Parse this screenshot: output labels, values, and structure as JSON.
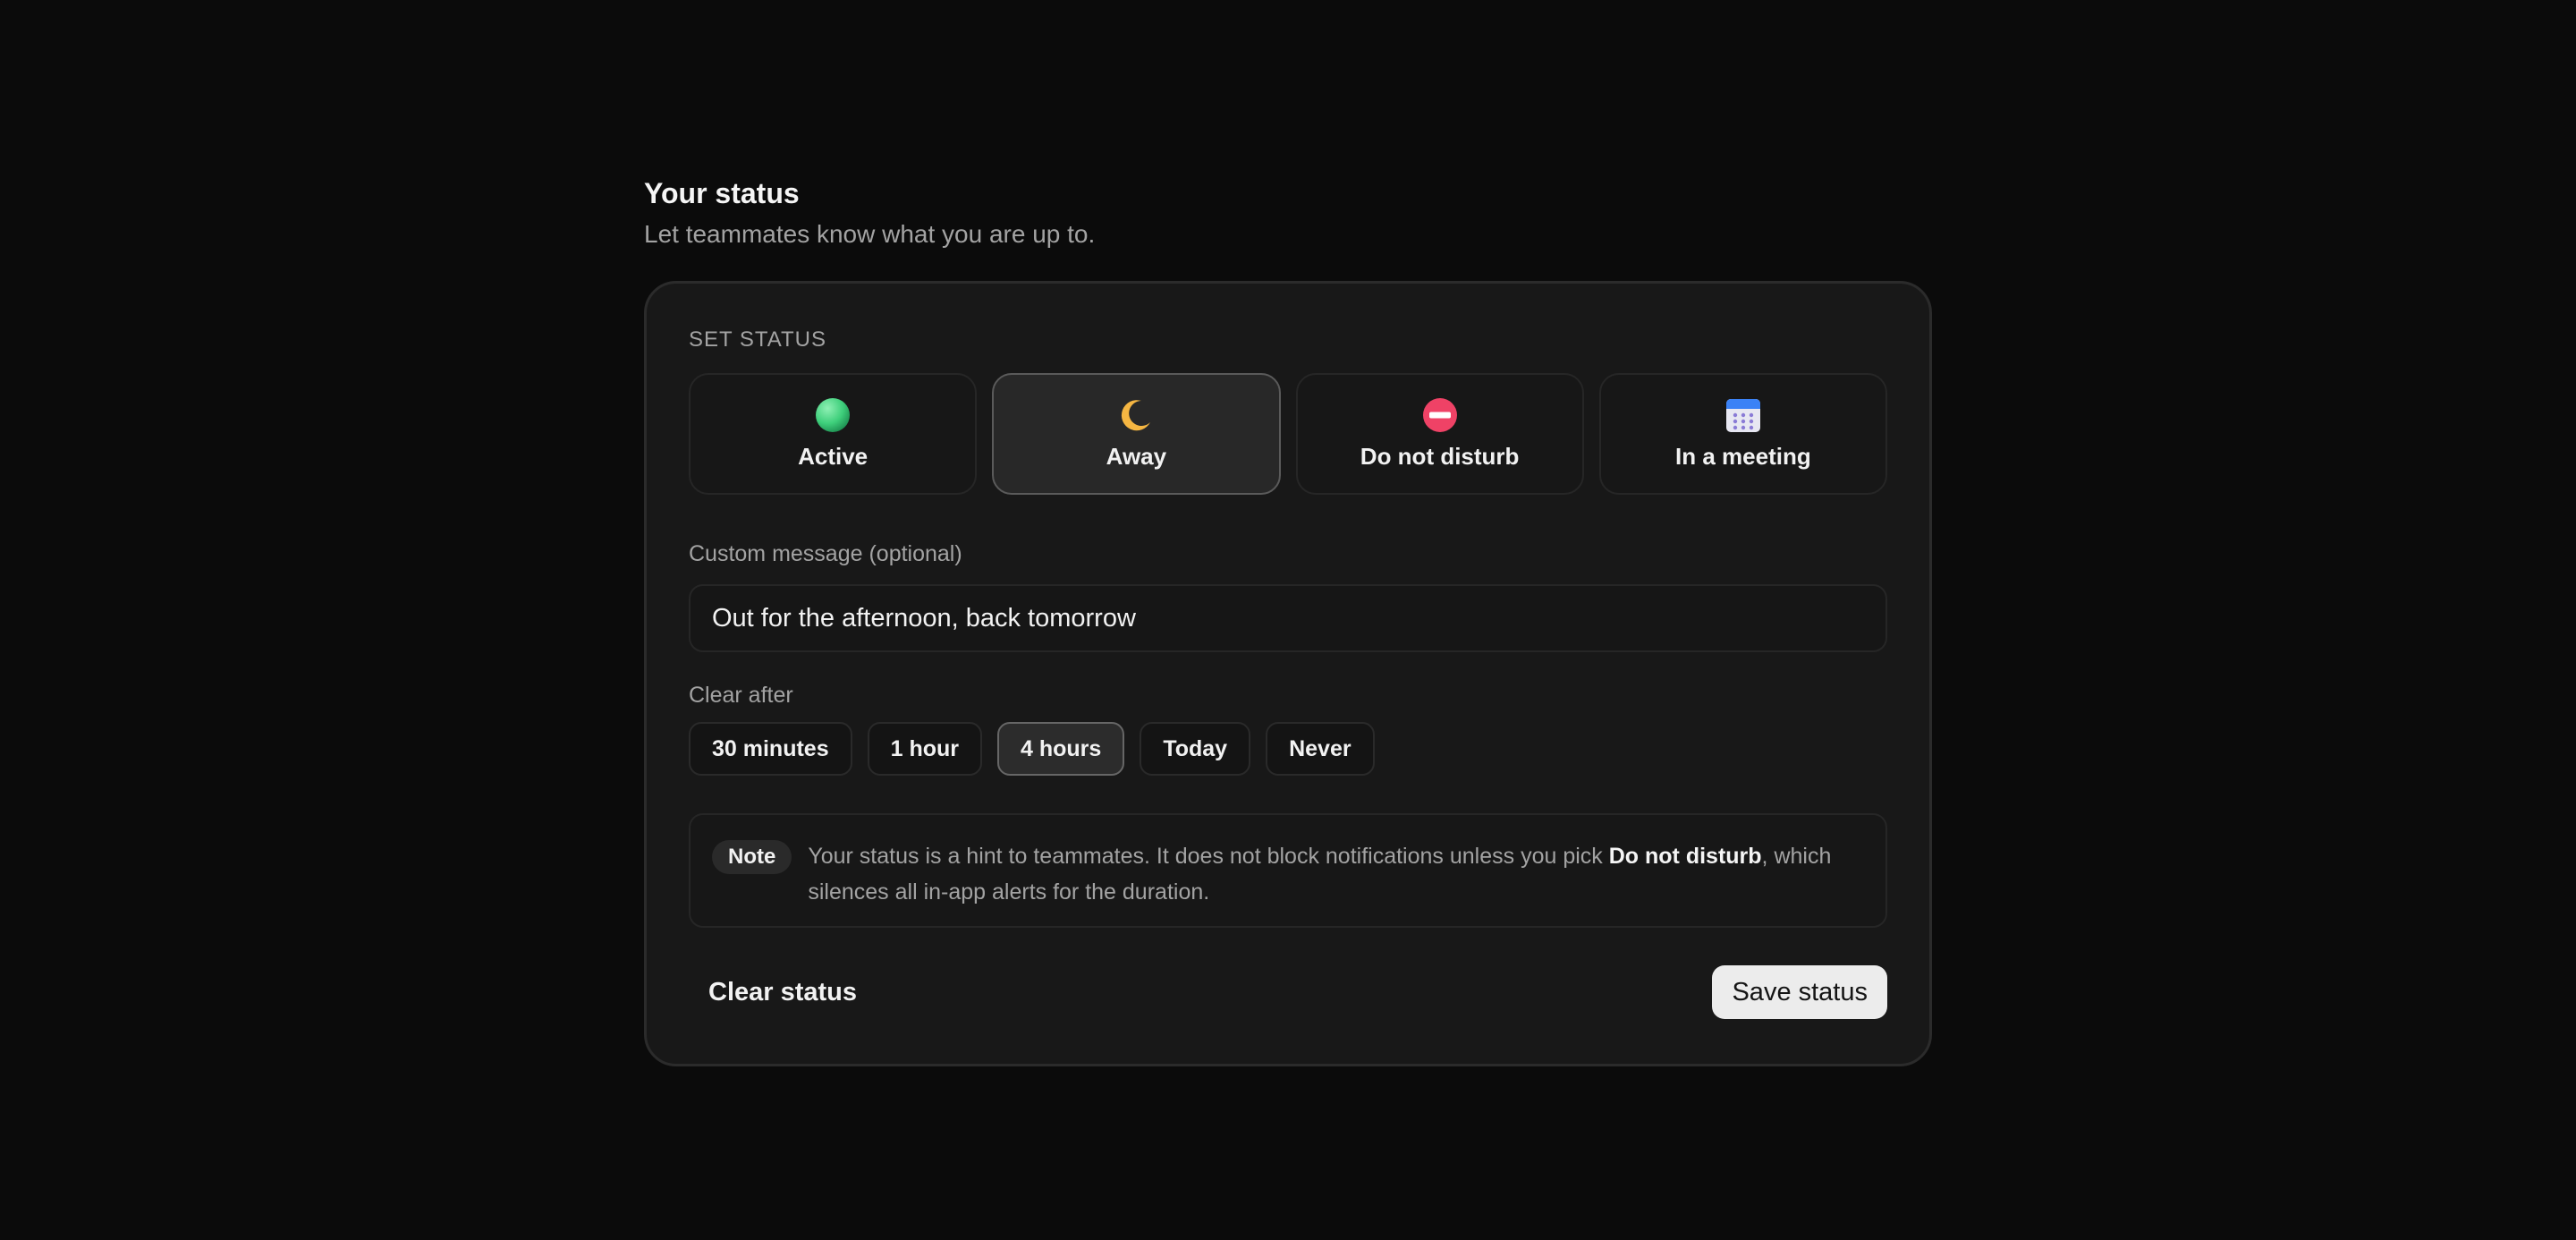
{
  "header": {
    "title": "Your status",
    "subtitle": "Let teammates know what you are up to."
  },
  "set_status": {
    "label": "SET STATUS",
    "selected": "away",
    "options": [
      {
        "id": "active",
        "label": "Active",
        "icon": "green-circle-icon",
        "color": "#3ecf7b"
      },
      {
        "id": "away",
        "label": "Away",
        "icon": "crescent-moon-icon",
        "color": "#f5b642"
      },
      {
        "id": "dnd",
        "label": "Do not disturb",
        "icon": "no-entry-icon",
        "color": "#ef4266"
      },
      {
        "id": "meeting",
        "label": "In a meeting",
        "icon": "calendar-icon",
        "color": "#3b82f6"
      }
    ]
  },
  "custom_message": {
    "label": "Custom message (optional)",
    "value": "Out for the afternoon, back tomorrow"
  },
  "clear_after": {
    "label": "Clear after",
    "selected": "4 hours",
    "options": [
      "30 minutes",
      "1 hour",
      "4 hours",
      "Today",
      "Never"
    ]
  },
  "note": {
    "tag": "Note",
    "text_before": "Your status is a hint to teammates. It does not block notifications unless you pick ",
    "emphasis": "Do not disturb",
    "text_after": ", which silences all in-app alerts for the duration."
  },
  "footer": {
    "clear_label": "Clear status",
    "save_label": "Save status"
  }
}
